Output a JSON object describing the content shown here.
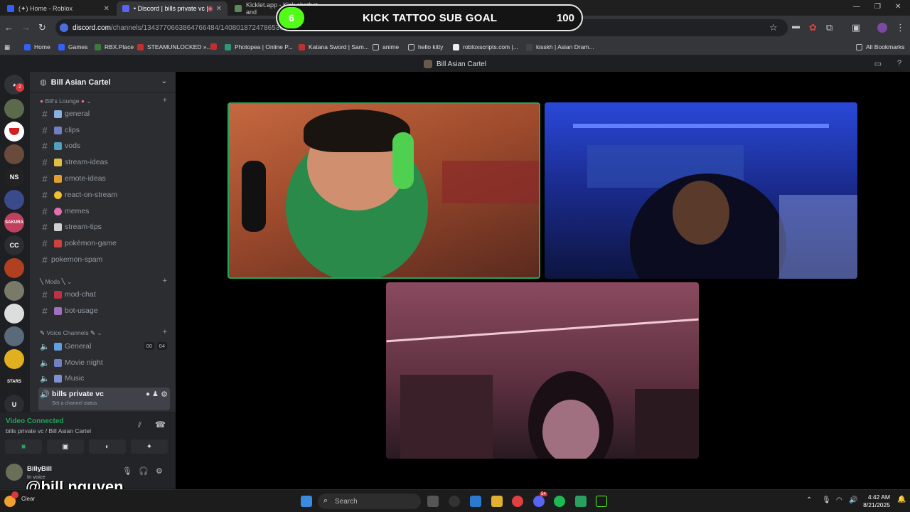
{
  "browser": {
    "tabs": [
      {
        "title": "(✦) Home - Roblox",
        "active": false
      },
      {
        "title": "• Discord | bills private vc |",
        "active": true
      },
      {
        "title": "Kicklet.app - Kick chatbot and",
        "active": false
      }
    ],
    "url_site": "discord.com",
    "url_path": "/channels/1343770663864766484/1408018724786536508",
    "bookmarks": [
      "Home",
      "Games",
      "RBX.Place",
      "STEAMUNLOCKED »...",
      "Photopea | Online P...",
      "Katana Sword | Sam...",
      "anime",
      "hello kitty",
      "robloxscripts.com |...",
      "kisskh | Asian Dram..."
    ],
    "all_bookmarks": "All Bookmarks"
  },
  "overlay": {
    "count": "6",
    "title": "KICK TATTOO SUB GOAL",
    "goal": "100",
    "progress_fraction": 0.06,
    "accent": "#53fc18"
  },
  "discord": {
    "window_title": "Bill Asian Cartel",
    "server_name": "Bill Asian Cartel",
    "rail": {
      "ns": "NS",
      "cc": "CC",
      "stars": "STARS",
      "u": "U",
      "sakura": "SAKURA",
      "ping": "2"
    },
    "categories": {
      "lounge": "Bill's Lounge",
      "mods": "Mods",
      "voice": "Voice Channels"
    },
    "text_channels": [
      "general",
      "clips",
      "vods",
      "stream-ideas",
      "emote-ideas",
      "react-on-stream",
      "memes",
      "stream-tips",
      "pokémon-game",
      "pokemon-spam"
    ],
    "mod_channels": [
      "mod-chat",
      "bot-usage"
    ],
    "voice_channels": [
      {
        "name": "General",
        "badge_a": "00",
        "badge_b": "04"
      },
      {
        "name": "Movie night"
      },
      {
        "name": "Music"
      }
    ],
    "selected_channel": {
      "name": "bills private vc",
      "status": "Set a channel status"
    },
    "voice_panel": {
      "status": "Video Connected",
      "location": "bills private vc / Bill Asian Cartel"
    },
    "user": {
      "name": "BillyBill",
      "status": "In voice"
    }
  },
  "stream_handle": "@bill.nguyen",
  "taskbar": {
    "search": "Search",
    "time": "4:42 AM",
    "date": "8/21/2025",
    "weather": "Clear",
    "discord_badge": "54"
  }
}
